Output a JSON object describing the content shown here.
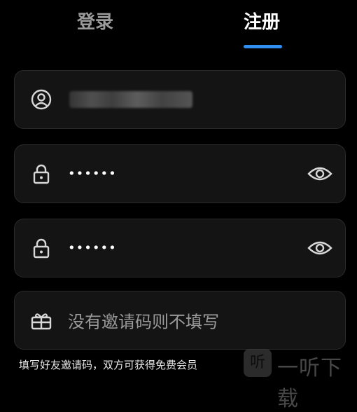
{
  "tabs": {
    "login": "登录",
    "register": "注册",
    "active": "register"
  },
  "fields": {
    "username": {
      "icon": "user-icon",
      "value_obscured": true
    },
    "password": {
      "icon": "lock-icon",
      "value": "••••••",
      "trailing_icon": "eye-icon"
    },
    "confirm_password": {
      "icon": "lock-icon",
      "value": "••••••",
      "trailing_icon": "eye-icon"
    },
    "invite_code": {
      "icon": "gift-icon",
      "placeholder": "没有邀请码则不填写"
    }
  },
  "hint": "填写好友邀请码，双方可获得免费会员",
  "watermark": {
    "box_char": "听",
    "text": "一听下载"
  },
  "colors": {
    "background": "#000000",
    "field": "#141414",
    "accent": "#2f8ef0",
    "inactive_tab": "#9a9a9a"
  }
}
